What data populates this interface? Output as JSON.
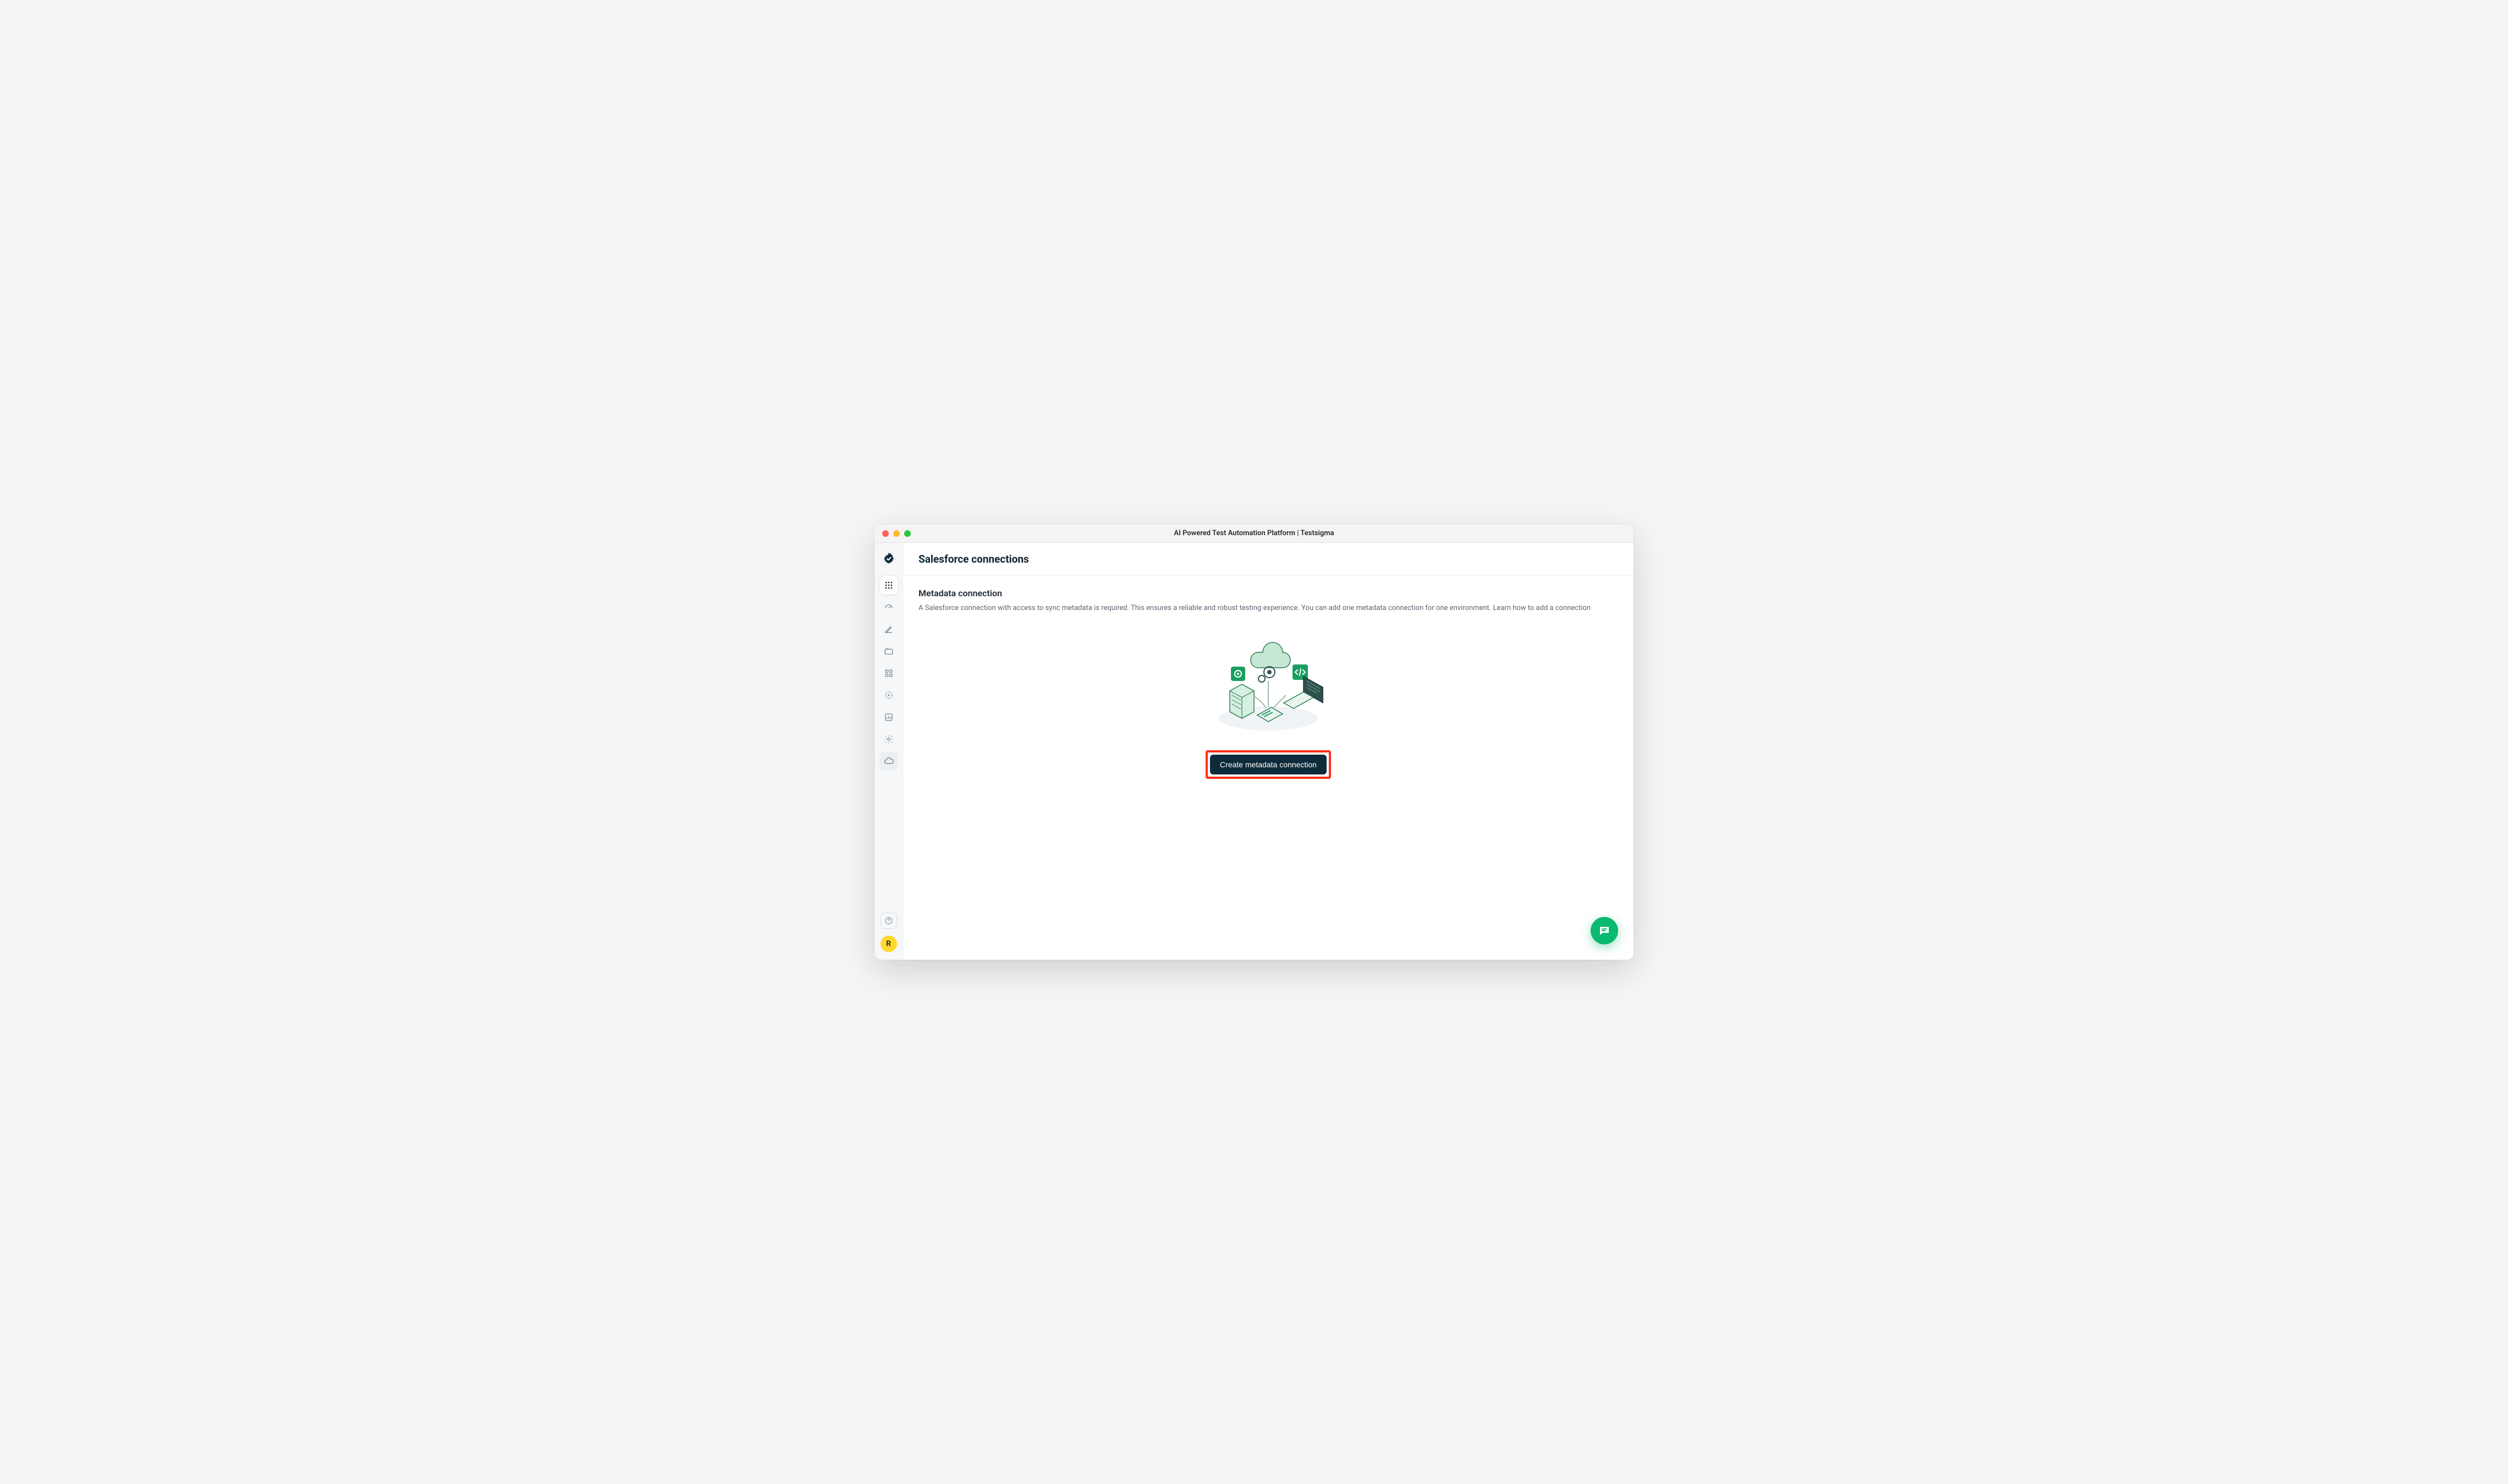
{
  "window": {
    "title": "AI Powered Test Automation Platform | Testsigma"
  },
  "sidebar": {
    "avatar_letter": "R"
  },
  "page": {
    "title": "Salesforce connections",
    "section_title": "Metadata connection",
    "section_description": "A Salesforce connection with access to sync metadata is required. This ensures a reliable and robust testing experience. You can add one metadata connection for one environment. ",
    "learn_link": "Learn how to add a connection",
    "cta_label": "Create metadata connection"
  }
}
